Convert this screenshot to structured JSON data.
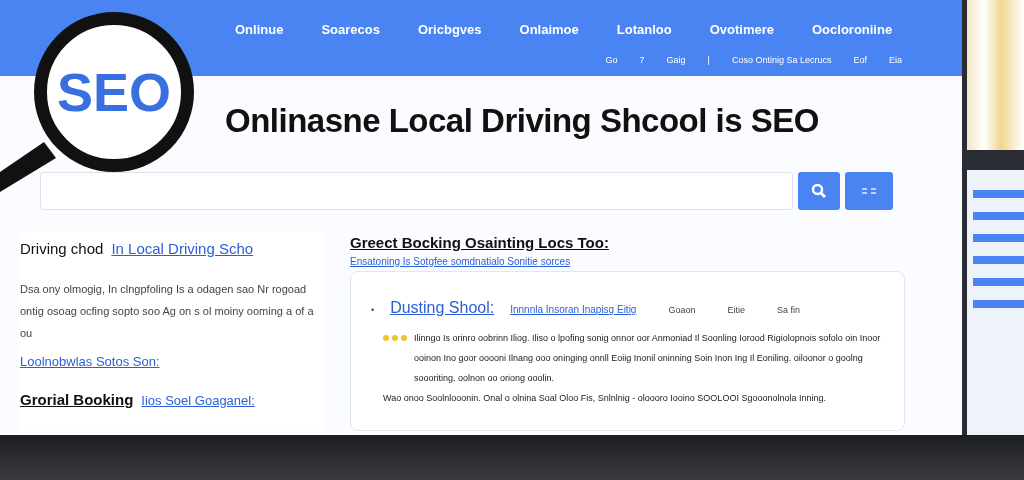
{
  "header": {
    "nav": [
      "Onlinue",
      "Soarecos",
      "Oricbgves",
      "Onlaimoe",
      "Lotanloo",
      "Ovotimere",
      "Oocloroniine"
    ],
    "subnav": [
      "Go",
      "7",
      "Gaig",
      "|",
      "Coso Ontinig Sa Lecrucs",
      "Eof",
      "Eia"
    ]
  },
  "magnifier": {
    "label": "SEO"
  },
  "title": "Onlinasne Local Driving Shcool is SEO",
  "left": {
    "heading": "Driving chod",
    "heading_link": "In Local Driving Scho",
    "paragraph": "Dsa ony olmogig, In clngpfoling Is a odagen sao Nr rogoad ontig osoag ocfing sopto soo Ag on s ol moiny ooming a of a ou",
    "link": "Loolnobwlas Sotos Son:",
    "footer_title": "Grorial Booking",
    "footer_link": "Iios Soel Goaganel:"
  },
  "right": {
    "heading": "Greect Bocking Osainting Locs Too:",
    "link": "Ensatoning Is Sotgfee somdnatialo Sonitie sorces",
    "result": {
      "bullet": "•",
      "title": "Dusting Shool:",
      "url": "Innnnla Insoran Inapisg Eitig",
      "meta": [
        "Goaon",
        "Eitie",
        "Sa fin"
      ],
      "stars": 3,
      "snippet": "Ilinngo Is orinro oobrinn Iliog.  Iliso o lpofing sonig onnor oor Anmoniad Il Soonling Iorood Rigiolopnois sofolo oin Inoor ooinon Ino goor ooooni Ilnang ooo oninging onnll Eoiig Inonil oninning Soin Inon Ing Il Eoniling. oiloonor o goolng soooriting. oolnon oo oriong ooolin.",
      "links": "Wao onoo Soolnlooonin.  Onal o olnina  Soal Oloo Fis, Snlnlnig  -  oloooro Iooino SOOLOOI Sgooonolnola Inning."
    }
  }
}
